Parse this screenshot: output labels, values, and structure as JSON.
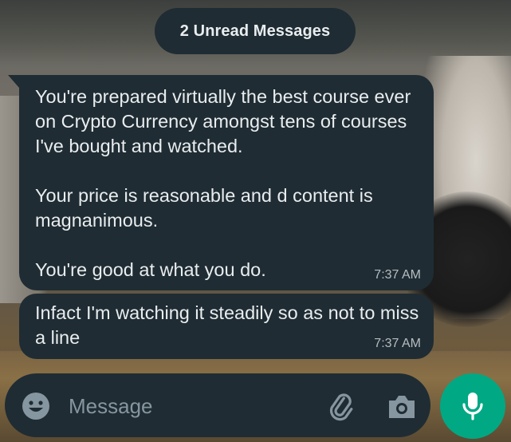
{
  "banner": {
    "unread_label": "2 Unread Messages"
  },
  "messages": [
    {
      "paragraphs": [
        "You're prepared virtually the best course ever on Crypto Currency amongst tens of courses I've bought and watched.",
        "Your price is reasonable and d content is magnanimous.",
        "You're good at what you do."
      ],
      "time": "7:37 AM"
    },
    {
      "paragraphs": [
        "Infact I'm watching it steadily so as not to miss a line"
      ],
      "time": "7:37 AM"
    }
  ],
  "composer": {
    "placeholder": "Message",
    "emoji_icon": "emoji-icon",
    "attach_icon": "paperclip-icon",
    "camera_icon": "camera-icon",
    "mic_icon": "microphone-icon"
  },
  "colors": {
    "bubble": "#1f2c33",
    "accent": "#00a884",
    "text": "#e9edef",
    "muted": "#8696a0"
  }
}
